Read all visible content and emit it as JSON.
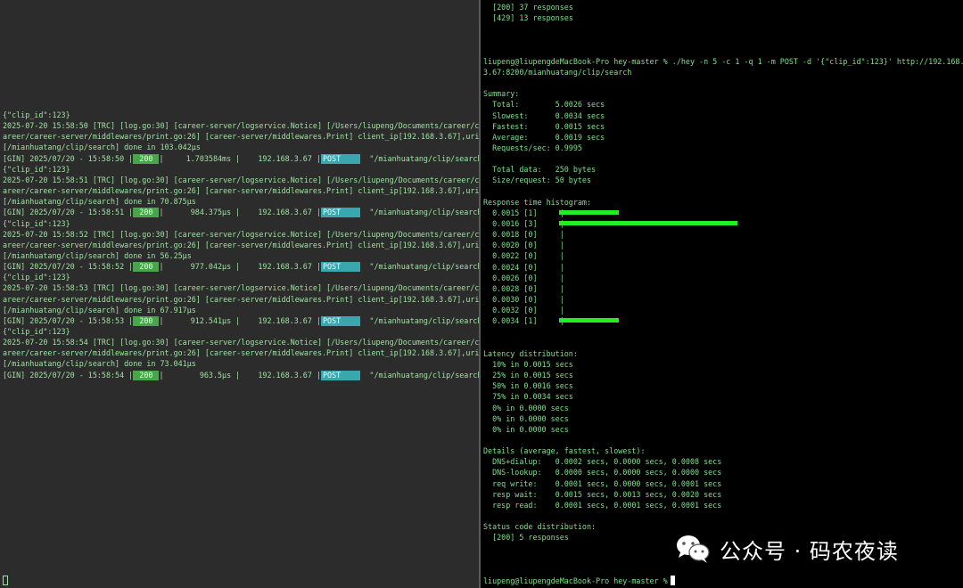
{
  "left_terminal": {
    "lines": [
      {
        "text": "{\"clip_id\":123}"
      },
      {
        "text": "2025-07-20 15:58:50 [TRC] [log.go:30] [career-server/logservice.Notice] [/Users/liupeng/Documents/career/c"
      },
      {
        "text": "areer/career-server/middlewares/print.go:26] [career-server/middlewares.Print] client_ip[192.168.3.67],uri"
      },
      {
        "text": "[/mianhuatang/clip/search] done in 103.042µs"
      },
      {
        "gin": {
          "prefix": "[GIN] 2025/07/20 - 15:58:50 |",
          "status": " 200 ",
          "mid": "|     1.703584ms |    192.168.3.67 |",
          "method": "POST    ",
          "path": "  \"/mianhuatang/clip/search\""
        }
      },
      {
        "text": "{\"clip_id\":123}"
      },
      {
        "text": "2025-07-20 15:58:51 [TRC] [log.go:30] [career-server/logservice.Notice] [/Users/liupeng/Documents/career/c"
      },
      {
        "text": "areer/career-server/middlewares/print.go:26] [career-server/middlewares.Print] client_ip[192.168.3.67],uri"
      },
      {
        "text": "[/mianhuatang/clip/search] done in 70.875µs"
      },
      {
        "gin": {
          "prefix": "[GIN] 2025/07/20 - 15:58:51 |",
          "status": " 200 ",
          "mid": "|      984.375µs |    192.168.3.67 |",
          "method": "POST    ",
          "path": "  \"/mianhuatang/clip/search\""
        }
      },
      {
        "text": "{\"clip_id\":123}"
      },
      {
        "text": "2025-07-20 15:58:52 [TRC] [log.go:30] [career-server/logservice.Notice] [/Users/liupeng/Documents/career/c"
      },
      {
        "text": "areer/career-server/middlewares/print.go:26] [career-server/middlewares.Print] client_ip[192.168.3.67],uri"
      },
      {
        "text": "[/mianhuatang/clip/search] done in 56.25µs"
      },
      {
        "gin": {
          "prefix": "[GIN] 2025/07/20 - 15:58:52 |",
          "status": " 200 ",
          "mid": "|      977.042µs |    192.168.3.67 |",
          "method": "POST    ",
          "path": "  \"/mianhuatang/clip/search\""
        }
      },
      {
        "text": "{\"clip_id\":123}"
      },
      {
        "text": "2025-07-20 15:58:53 [TRC] [log.go:30] [career-server/logservice.Notice] [/Users/liupeng/Documents/career/c"
      },
      {
        "text": "areer/career-server/middlewares/print.go:26] [career-server/middlewares.Print] client_ip[192.168.3.67],uri"
      },
      {
        "text": "[/mianhuatang/clip/search] done in 67.917µs"
      },
      {
        "gin": {
          "prefix": "[GIN] 2025/07/20 - 15:58:53 |",
          "status": " 200 ",
          "mid": "|      912.541µs |    192.168.3.67 |",
          "method": "POST    ",
          "path": "  \"/mianhuatang/clip/search\""
        }
      },
      {
        "text": "{\"clip_id\":123}"
      },
      {
        "text": "2025-07-20 15:58:54 [TRC] [log.go:30] [career-server/logservice.Notice] [/Users/liupeng/Documents/career/c"
      },
      {
        "text": "areer/career-server/middlewares/print.go:26] [career-server/middlewares.Print] client_ip[192.168.3.67],uri"
      },
      {
        "text": "[/mianhuatang/clip/search] done in 73.041µs"
      },
      {
        "gin": {
          "prefix": "[GIN] 2025/07/20 - 15:58:54 |",
          "status": " 200 ",
          "mid": "|        963.5µs |    192.168.3.67 |",
          "method": "POST    ",
          "path": "  \"/mianhuatang/clip/search\""
        }
      }
    ]
  },
  "right_terminal": {
    "lines": [
      {
        "text": "  [200] 37 responses"
      },
      {
        "text": "  [429] 13 responses"
      },
      {
        "text": ""
      },
      {
        "text": ""
      },
      {
        "text": ""
      },
      {
        "text": "liupeng@liupengdeMacBook-Pro hey-master % ./hey -n 5 -c 1 -q 1 -m POST -d '{\"clip_id\":123}' http://192.168."
      },
      {
        "text": "3.67:8200/mianhuatang/clip/search"
      },
      {
        "text": ""
      },
      {
        "text": "Summary:"
      },
      {
        "text": "  Total:        5.0026 secs"
      },
      {
        "text": "  Slowest:      0.0034 secs"
      },
      {
        "text": "  Fastest:      0.0015 secs"
      },
      {
        "text": "  Average:      0.0019 secs"
      },
      {
        "text": "  Requests/sec: 0.9995"
      },
      {
        "text": ""
      },
      {
        "text": "  Total data:   250 bytes"
      },
      {
        "text": "  Size/request: 50 bytes"
      },
      {
        "text": ""
      },
      {
        "text": "Response time histogram:"
      },
      {
        "hist": {
          "label": "  0.0015 [1]     |",
          "count": 1
        }
      },
      {
        "hist": {
          "label": "  0.0016 [3]     |",
          "count": 3
        }
      },
      {
        "hist": {
          "label": "  0.0018 [0]     |",
          "count": 0
        }
      },
      {
        "hist": {
          "label": "  0.0020 [0]     |",
          "count": 0
        }
      },
      {
        "hist": {
          "label": "  0.0022 [0]     |",
          "count": 0
        }
      },
      {
        "hist": {
          "label": "  0.0024 [0]     |",
          "count": 0
        }
      },
      {
        "hist": {
          "label": "  0.0026 [0]     |",
          "count": 0
        }
      },
      {
        "hist": {
          "label": "  0.0028 [0]     |",
          "count": 0
        }
      },
      {
        "hist": {
          "label": "  0.0030 [0]     |",
          "count": 0
        }
      },
      {
        "hist": {
          "label": "  0.0032 [0]     |",
          "count": 0
        }
      },
      {
        "hist": {
          "label": "  0.0034 [1]     |",
          "count": 1
        }
      },
      {
        "text": ""
      },
      {
        "text": ""
      },
      {
        "text": "Latency distribution:"
      },
      {
        "text": "  10% in 0.0015 secs"
      },
      {
        "text": "  25% in 0.0015 secs"
      },
      {
        "text": "  50% in 0.0016 secs"
      },
      {
        "text": "  75% in 0.0034 secs"
      },
      {
        "text": "  0% in 0.0000 secs"
      },
      {
        "text": "  0% in 0.0000 secs"
      },
      {
        "text": "  0% in 0.0000 secs"
      },
      {
        "text": ""
      },
      {
        "text": "Details (average, fastest, slowest):"
      },
      {
        "text": "  DNS+dialup:   0.0002 secs, 0.0000 secs, 0.0008 secs"
      },
      {
        "text": "  DNS-lookup:   0.0000 secs, 0.0000 secs, 0.0000 secs"
      },
      {
        "text": "  req write:    0.0001 secs, 0.0000 secs, 0.0001 secs"
      },
      {
        "text": "  resp wait:    0.0015 secs, 0.0013 secs, 0.0020 secs"
      },
      {
        "text": "  resp read:    0.0001 secs, 0.0001 secs, 0.0001 secs"
      },
      {
        "text": ""
      },
      {
        "text": "Status code distribution:"
      },
      {
        "text": "  [200] 5 responses"
      }
    ],
    "prompt": "liupeng@liupengdeMacBook-Pro hey-master % "
  },
  "watermark": {
    "text": "公众号 · 码农夜读",
    "icon": "wechat-icon"
  },
  "colors": {
    "left_bg": "#2c2c2c",
    "right_bg": "#000000",
    "text_green": "#9ee2a0",
    "status_badge": "#44a846",
    "method_badge": "#3aa6ad",
    "histogram_bar": "#22ee22"
  }
}
